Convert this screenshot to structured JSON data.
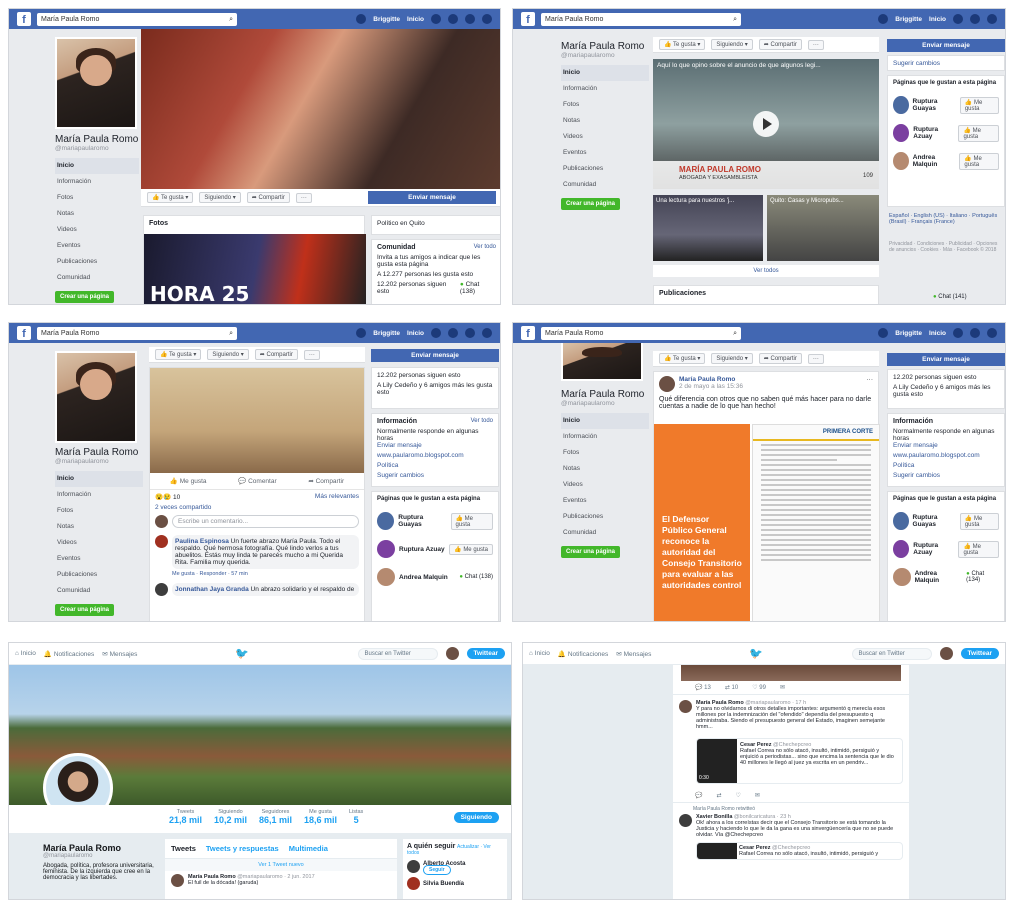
{
  "fb": {
    "search": "María Paula Romo",
    "user": "Briggitte",
    "home": "Inicio",
    "name": "María Paula Romo",
    "handle": "@mariapaularomo",
    "nav": [
      "Inicio",
      "Información",
      "Fotos",
      "Notas",
      "Videos",
      "Eventos",
      "Publicaciones",
      "Comunidad"
    ],
    "create_page": "Crear una página",
    "like": "Te gusta",
    "follow": "Siguiendo",
    "share": "Compartir",
    "send_message": "Enviar mensaje",
    "suggest": "Sugerir cambios",
    "liked_pages": "Páginas que le gustan a esta página",
    "page1": "Ruptura Guayas",
    "page2": "Ruptura Azuay",
    "page3": "Andrea Malquin",
    "likepage": "Me gusta",
    "chat1": "Chat (138)",
    "chat2": "Chat (141)",
    "chat3": "Chat (134)",
    "photos": "Fotos",
    "category": "Político en Quito",
    "community": "Comunidad",
    "see_all": "Ver todo",
    "invite": "Invita a tus amigos a indicar que les gusta esta página",
    "likes_count": "A 12.277 personas les gusta esto",
    "followers": "12.202 personas siguen esto",
    "friends_like": "A Lily Cedeño y 6 amigos más les gusta esto",
    "hora": "HORA 25",
    "video_title": "Aquí lo que opino sobre el anuncio de que algunos legi...",
    "video_banner": "MARÍA PAULA ROMO",
    "video_sub": "ABOGADA Y EXASAMBLEISTA",
    "video_views": "109",
    "thumb1": "Una lectura para nuestros 'j...",
    "thumb2": "Quito: Casas y Micropubs...",
    "see_all_videos": "Ver todos",
    "publicaciones": "Publicaciones",
    "langs": "Español · English (US) · Italiano · Português (Brasil) · Français (France)",
    "footer": "Privacidad · Condiciones · Publicidad · Opciones de anuncios · Cookies · Más · Facebook © 2018",
    "comment_like": "Me gusta",
    "comment_comment": "Comentar",
    "comment_share": "Compartir",
    "reactions": "10",
    "most_relevant": "Más relevantes",
    "shared": "2 veces compartido",
    "write_comment": "Escribe un comentario...",
    "c1_name": "Paulina Espinosa",
    "c1_text": "Un fuerte abrazo María Paula. Todo el respaldo. Qué hermosa fotografía. Qué lindo verlos a tus abuelitos. Estás muy linda te parecés mucho a mi Querida Rita. Familia muy querida.",
    "c1_meta": "Me gusta · Responder · 57 min",
    "c2_name": "Jonnathan Jaya Granda",
    "c2_text": "Un abrazo solidario y el respaldo de",
    "info": "Información",
    "info1": "Normalmente responde en algunas horas",
    "info1b": "Enviar mensaje",
    "info2": "www.paularomo.blogspot.com",
    "info3": "Política",
    "post_name": "María Paula Romo",
    "post_date": "2 de mayo a las 15:36",
    "post_text": "Qué diferencia con otros que no saben qué más hacer para no darle cuentas a nadie de lo que han hecho!",
    "orange_text": "El Defensor Público General reconoce la autoridad del Consejo Transitorio para evaluar a las autoridades control",
    "doc_head": "PRIMERA CORTE"
  },
  "tw": {
    "home": "Inicio",
    "notif": "Notificaciones",
    "messages": "Mensajes",
    "search": "Buscar en Twitter",
    "tweet_btn": "Twittear",
    "name": "María Paula Romo",
    "handle": "@mariapaularomo",
    "bio": "Abogada, política, profesora universitaria, feminista. De la izquierda que cree en la democracia y las libertades.",
    "stats": [
      {
        "l": "Tweets",
        "v": "21,8 mil"
      },
      {
        "l": "Siguiendo",
        "v": "10,2 mil"
      },
      {
        "l": "Seguidores",
        "v": "86,1 mil"
      },
      {
        "l": "Me gusta",
        "v": "18,6 mil"
      },
      {
        "l": "Listas",
        "v": "5"
      }
    ],
    "following_btn": "Siguiendo",
    "tab1": "Tweets",
    "tab2": "Tweets y respuestas",
    "tab3": "Multimedia",
    "new_tweet": "Ver 1 Tweet nuevo",
    "who_follow": "A quién seguir",
    "update": "Actualizar · Ver todos",
    "follow_btn": "Seguir",
    "sug1": "Alberto Acosta",
    "sug2": "Silvia Buendía",
    "pinned_name": "María Paula Romo",
    "pinned_meta": "@mariapaularomo · 2 jun. 2017",
    "pinned_text": "El fuil de la dócada! (garuda)",
    "t1_name": "María Paula Romo",
    "t1_meta": "@mariapaularomo · 17 h",
    "t1_text": "Y para no olvidarnos di otros detalles importantes: argumentó q merecía esos millones por la indemnización del \"ofendido\" dependía del presupuesto q administraba. Siendo el presupuesto general del Estado, imaginen semejante hmm...",
    "q1_name": "Cesar Perez",
    "q1_handle": "@Chechepcreo",
    "q1_text": "Rafael Correa no sólo atacó, insultó, intimidó, persiguió y enjuició a periodistas... sino que encima la sentencia que le dio 40 millones le llegó al juez ya escrita en un pendriv...",
    "video_time": "0:30",
    "retweeted": "María Paula Romo retwitteó",
    "t2_name": "Xavier Bonilla",
    "t2_meta": "@bonilcaricatura · 23 h",
    "t2_text": "Ok! ahora a los correístas decir que el Consejo Transitorio se está tomando la Justicia y haciendo lo que le da la gana es una sinvergüencería que no se puede olvidar. Vía @Chechepcreo",
    "q2_text": "Rafael Correa no sólo atacó, insultó, intimidó, persiguió y",
    "counts1": [
      "13",
      "10",
      "99"
    ],
    "counts2": [
      "",
      "",
      ""
    ]
  }
}
